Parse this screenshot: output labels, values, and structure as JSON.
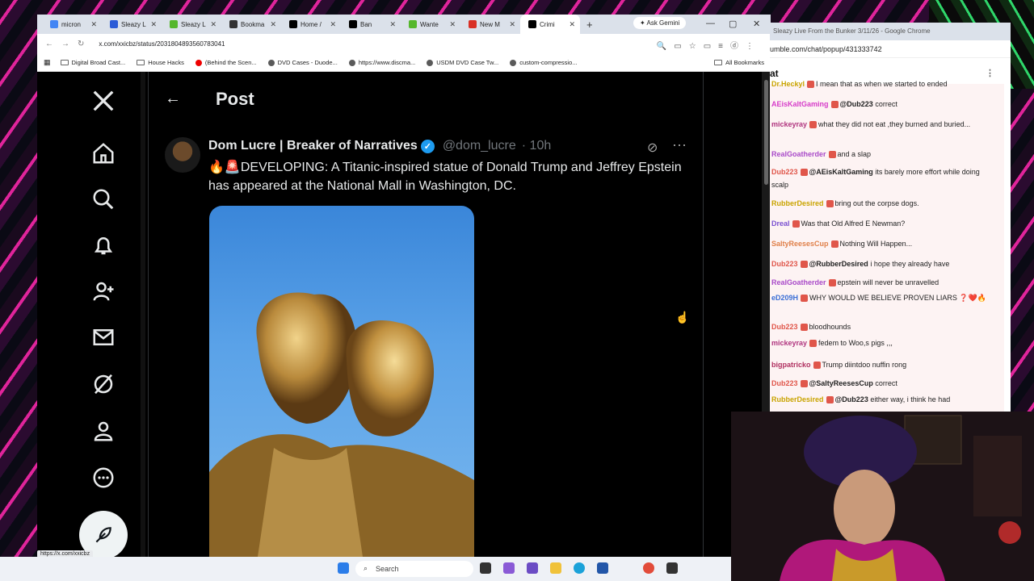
{
  "browser": {
    "tabs": [
      {
        "label": "micron",
        "favicon": "google-icon",
        "color": "#4285f4"
      },
      {
        "label": "Sleazy L",
        "favicon": "b-icon",
        "color": "#2b5bd7"
      },
      {
        "label": "Sleazy L",
        "favicon": "rumble-icon",
        "color": "#55b72c"
      },
      {
        "label": "Bookma",
        "favicon": "bookmark-icon",
        "color": "#333"
      },
      {
        "label": "Home /",
        "favicon": "x-icon",
        "color": "#000"
      },
      {
        "label": "Ban",
        "favicon": "x-icon",
        "color": "#000"
      },
      {
        "label": "Wante",
        "favicon": "rumble-icon",
        "color": "#55b72c"
      },
      {
        "label": "New M",
        "favicon": "gmail-icon",
        "color": "#d93025"
      },
      {
        "label": "Crimi",
        "favicon": "x-icon",
        "color": "#000"
      }
    ],
    "active_tab": 8,
    "ask_gemini": "Ask Gemini",
    "url": "x.com/xxicbz/status/2031804893560783041",
    "bookmarks": [
      {
        "label": "Digital Broad Cast...",
        "icon": "folder-icon"
      },
      {
        "label": "House Hacks",
        "icon": "folder-icon"
      },
      {
        "label": "(Behind the Scen...",
        "icon": "youtube-icon"
      },
      {
        "label": "DVD Cases - Duode...",
        "icon": "site-icon"
      },
      {
        "label": "https://www.discma...",
        "icon": "site-icon"
      },
      {
        "label": "USDM DVD Case Tw...",
        "icon": "site-icon"
      },
      {
        "label": "custom-compressio...",
        "icon": "site-icon"
      }
    ],
    "all_bookmarks": "All Bookmarks",
    "status_url": "https://x.com/xxicbz"
  },
  "x_page": {
    "header_title": "Post",
    "author_name": "Dom Lucre | Breaker of Narratives",
    "author_handle": "@dom_lucre",
    "time": "· 10h",
    "post_text": "🔥🚨DEVELOPING: A Titanic-inspired statue of Donald Trump and Jeffrey Epstein has appeared at the National Mall in Washington, DC.",
    "nav_icons": [
      "x-logo-icon",
      "home-icon",
      "search-icon",
      "bell-icon",
      "follow-icon",
      "mail-icon",
      "grok-icon",
      "profile-icon",
      "more-icon"
    ]
  },
  "chat": {
    "window_title": "Sleazy Live From the Bunker 3/11/26 - Google Chrome",
    "url": "umble.com/chat/popup/431333742",
    "heading": "at",
    "messages": [
      {
        "user": "Dr.Heckyl",
        "color": "#c9a400",
        "mention": "",
        "text": "I mean that as when we started to ended"
      },
      {
        "user": "AEisKaltGaming",
        "color": "#d63cc9",
        "mention": "@Dub223",
        "text": "correct"
      },
      {
        "user": "mickeyray",
        "color": "#b0357f",
        "mention": "",
        "text": "what they did not eat ,they burned and buried..."
      },
      {
        "user": "RealGoatherder",
        "color": "#a94bc9",
        "mention": "",
        "text": "and a slap"
      },
      {
        "user": "Dub223",
        "color": "#e0564a",
        "mention": "@AEisKaltGaming",
        "text": "its barely more effort while doing scalp"
      },
      {
        "user": "RubberDesired",
        "color": "#c9a400",
        "mention": "",
        "text": "bring out the corpse dogs."
      },
      {
        "user": "Dreal",
        "color": "#7a50d0",
        "mention": "",
        "text": "Was that Old Alfred E Newman?"
      },
      {
        "user": "SaltyReesesCup",
        "color": "#e0804a",
        "mention": "",
        "text": "Nothing Will Happen..."
      },
      {
        "user": "Dub223",
        "color": "#e0564a",
        "mention": "@RubberDesired",
        "text": "i hope they already have"
      },
      {
        "user": "RealGoatherder",
        "color": "#a94bc9",
        "mention": "",
        "text": "epstein will never be unravelled"
      },
      {
        "user": "eD209H",
        "color": "#3c6fd6",
        "mention": "",
        "text": "WHY WOULD WE BELIEVE PROVEN LIARS ❓❤️🔥"
      },
      {
        "user": "Dub223",
        "color": "#e0564a",
        "mention": "",
        "text": "bloodhounds"
      },
      {
        "user": "mickeyray",
        "color": "#b0357f",
        "mention": "",
        "text": "fedem to Woo,s pigs ,,,"
      },
      {
        "user": "bigpatricko",
        "color": "#b03060",
        "mention": "",
        "text": "Trump diintdoo nuffin rong"
      },
      {
        "user": "Dub223",
        "color": "#e0564a",
        "mention": "@SaltyReesesCup",
        "text": "correct"
      },
      {
        "user": "RubberDesired",
        "color": "#c9a400",
        "mention": "@Dub223",
        "text": "either way, i think he had"
      }
    ]
  },
  "taskbar": {
    "search_label": "Search"
  }
}
